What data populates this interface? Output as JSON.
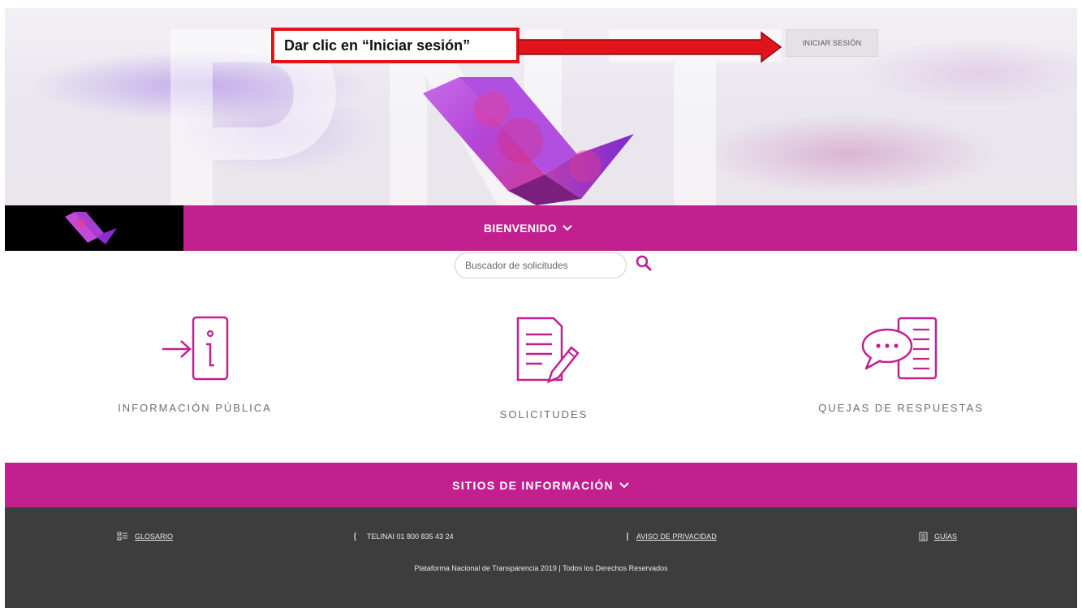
{
  "hero": {
    "watermark": "PNT",
    "callout_text": "Dar clic en “Iniciar sesión”",
    "login_label": "INICIAR SESIÓN"
  },
  "nav": {
    "welcome_label": "BIENVENIDO"
  },
  "search": {
    "placeholder": "Buscador de solicitudes"
  },
  "features": [
    {
      "label": "INFORMACIÓN PÚBLICA",
      "icon": "information-entry-icon"
    },
    {
      "label": "SOLICITUDES",
      "icon": "document-edit-icon"
    },
    {
      "label": "QUEJAS DE RESPUESTAS",
      "icon": "chat-complaint-icon"
    }
  ],
  "sitios": {
    "label": "SITIOS DE INFORMACIÓN"
  },
  "footer": {
    "links": [
      {
        "label": "GLOSARIO",
        "icon": "glossary-icon"
      },
      {
        "label": "TELINAI 01 800 835 43 24",
        "icon": "phone-icon"
      },
      {
        "label": "AVISO DE PRIVACIDAD",
        "icon": "privacy-icon"
      },
      {
        "label": "GUÍAS",
        "icon": "guide-icon"
      }
    ],
    "copyright": "Plataforma Nacional de Transparencia 2019 | Todos los Derechos Reservados"
  },
  "colors": {
    "brand_magenta": "#c2208f",
    "callout_red": "#e1141b",
    "footer_bg": "#3d3d3d"
  }
}
